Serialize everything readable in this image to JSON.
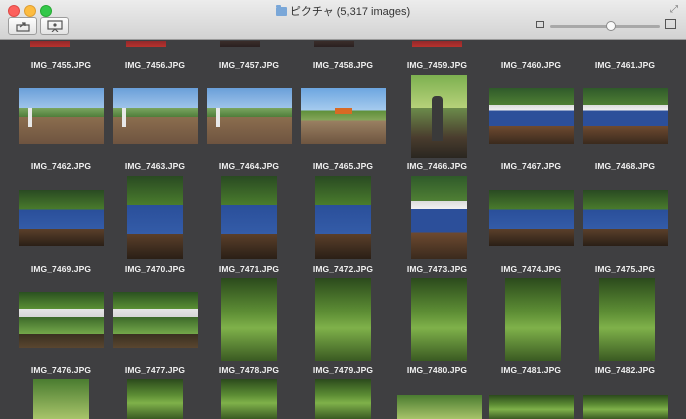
{
  "window": {
    "title": "ピクチャ (5,317 images)"
  },
  "toolbar": {
    "share_icon": "share-icon",
    "slideshow_icon": "slideshow-icon",
    "thumb_size_level": 0.55
  },
  "rows": [
    [
      "IMG_7455.JPG",
      "IMG_7456.JPG",
      "IMG_7457.JPG",
      "IMG_7458.JPG",
      "IMG_7459.JPG",
      "IMG_7460.JPG",
      "IMG_7461.JPG"
    ],
    [
      "IMG_7462.JPG",
      "IMG_7463.JPG",
      "IMG_7464.JPG",
      "IMG_7465.JPG",
      "IMG_7466.JPG",
      "IMG_7467.JPG",
      "IMG_7468.JPG"
    ],
    [
      "IMG_7469.JPG",
      "IMG_7470.JPG",
      "IMG_7471.JPG",
      "IMG_7472.JPG",
      "IMG_7473.JPG",
      "IMG_7474.JPG",
      "IMG_7475.JPG"
    ],
    [
      "IMG_7476.JPG",
      "IMG_7477.JPG",
      "IMG_7478.JPG",
      "IMG_7479.JPG",
      "IMG_7480.JPG",
      "IMG_7481.JPG",
      "IMG_7482.JPG"
    ]
  ],
  "colors": {
    "background": "#3f3f41",
    "caption": "#f0f0f0"
  }
}
